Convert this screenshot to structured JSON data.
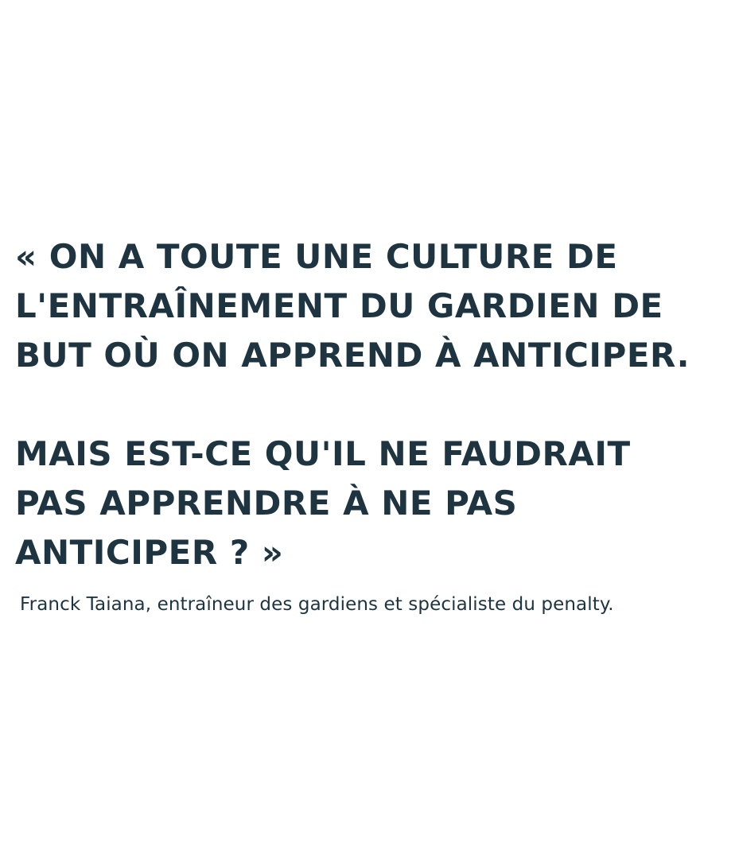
{
  "quote": {
    "paragraph1": [
      "« On a toute une culture de",
      "l'entraînement du gardien de",
      "but où on apprend à anticiper."
    ],
    "paragraph2": [
      "Mais est-ce qu'il ne faudrait",
      "pas apprendre à ne pas",
      "anticiper ? »"
    ]
  },
  "attribution": "Franck Taiana, entraîneur des gardiens et spécialiste du penalty.",
  "colors": {
    "text": "#1e3440",
    "background": "#ffffff"
  }
}
